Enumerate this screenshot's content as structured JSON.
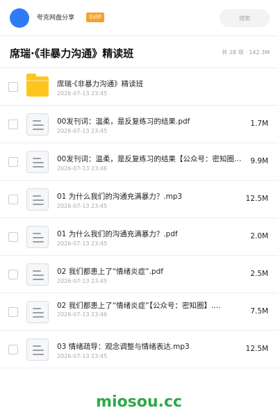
{
  "topbar": {
    "app_name": "夸克网盘分享",
    "badge": "SVIP",
    "search_placeholder": "搜索"
  },
  "header": {
    "title": "席瑞·《非暴力沟通》精读班",
    "meta": "共 28 项 · 142.3M"
  },
  "files": [
    {
      "type": "folder",
      "name": "席瑞·《非暴力沟通》精读班",
      "date": "2026-07-13 23:45",
      "size": ""
    },
    {
      "type": "file",
      "name": "00发刊词：温柔，是反复练习的结果.pdf",
      "date": "2026-07-13 23:45",
      "size": "1.7M"
    },
    {
      "type": "file",
      "name": "00发刊词：温柔，是反复练习的结果【公众号：密知圈…",
      "date": "2026-07-13 23:46",
      "size": "9.9M"
    },
    {
      "type": "file",
      "name": "01 为什么我们的沟通充满暴力？.mp3",
      "date": "2026-07-13 23:45",
      "size": "12.5M"
    },
    {
      "type": "file",
      "name": "01 为什么我们的沟通充满暴力？.pdf",
      "date": "2026-07-13 23:45",
      "size": "2.0M"
    },
    {
      "type": "file",
      "name": "02 我们都患上了“情绪炎症”.pdf",
      "date": "2026-07-13 23:45",
      "size": "2.5M"
    },
    {
      "type": "file",
      "name": "02 我们都患上了“情绪炎症”【公众号：密知圈】.…",
      "date": "2026-07-13 23:46",
      "size": "7.5M",
      "wrap": true
    },
    {
      "type": "file",
      "name": "03 情绪疏导：观念调整与情绪表达.mp3",
      "date": "2026-07-13 23:45",
      "size": "12.5M"
    }
  ],
  "watermark": "miosou.cc"
}
